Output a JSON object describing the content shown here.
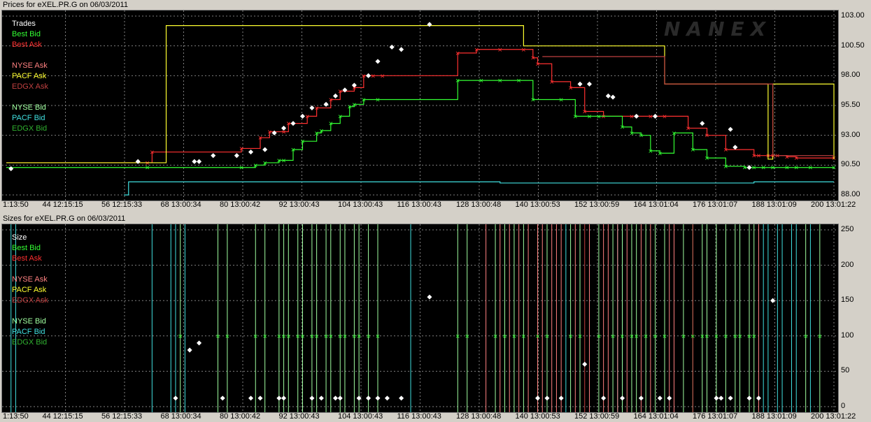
{
  "top_title": "Prices for  eXEL.PR.G  on  06/03/2011",
  "bottom_title": "Sizes for  eXEL.PR.G  on  06/03/2011",
  "logo_text": "NANEX",
  "colors": {
    "trades": "#ffffff",
    "best_bid": "#33ff33",
    "best_ask": "#ff3030",
    "nyse_ask": "#ff8080",
    "pacf_ask": "#ffff30",
    "edgx_ask": "#c04040",
    "nyse_bid": "#a0ffa0",
    "pacf_bid": "#40e0e0",
    "edgx_bid": "#30b030",
    "grid": "#808080"
  },
  "x_tick_labels": [
    "1:13:50",
    "44 12:15:15",
    "56 12:15:33",
    "68 13:00:34",
    "80 13:00:42",
    "92 13:00:43",
    "104 13:00:43",
    "116 13:00:43",
    "128 13:00:48",
    "140 13:00:53",
    "152 13:00:59",
    "164 13:01:04",
    "176 13:01:07",
    "188 13:01:09",
    "200 13:01:22"
  ],
  "chart_data": [
    {
      "type": "line",
      "panel": "prices",
      "title": "Prices for  eXEL.PR.G  on  06/03/2011",
      "ylim": [
        88.0,
        103.0
      ],
      "y_ticks": [
        "103.00",
        "100.50",
        "98.00",
        "95.50",
        "93.00",
        "90.50",
        "88.00"
      ],
      "x_index_range": [
        32,
        208
      ],
      "legend": [
        "Trades",
        "Best Bid",
        "Best Ask",
        "NYSE Ask",
        "PACF Ask",
        "EDGX Ask",
        "NYSE Bid",
        "PACF Bid",
        "EDGX Bid"
      ],
      "legend_position": "top-left",
      "grid": true,
      "series": [
        {
          "name": "Best Ask",
          "color_key": "best_ask",
          "x": [
            32,
            62,
            63,
            82,
            86,
            88,
            91,
            92,
            96,
            98,
            101,
            103,
            106,
            108,
            110,
            112,
            128,
            132,
            137,
            142,
            144,
            145,
            148,
            152,
            155,
            159,
            165,
            169,
            172,
            177,
            181,
            185,
            191,
            192,
            194,
            195,
            196,
            198,
            200,
            208
          ],
          "y": [
            90.7,
            90.7,
            91.6,
            91.9,
            92.8,
            93.3,
            93.3,
            94.0,
            94.6,
            95.3,
            96.0,
            96.7,
            97.0,
            98.0,
            98.0,
            98.0,
            99.9,
            100.2,
            100.2,
            100.2,
            99.5,
            99.0,
            97.5,
            97.0,
            95.0,
            94.6,
            94.6,
            94.6,
            94.6,
            93.6,
            93.0,
            91.8,
            91.3,
            91.3,
            91.3,
            91.3,
            91.3,
            91.2,
            91.1,
            91.1
          ]
        },
        {
          "name": "Best Bid",
          "color_key": "best_bid",
          "x": [
            32,
            62,
            82,
            85,
            87,
            90,
            91,
            93,
            95,
            98,
            99,
            101,
            103,
            105,
            106,
            108,
            111,
            128,
            133,
            137,
            141,
            144,
            150,
            153,
            156,
            158,
            163,
            165,
            167,
            169,
            171,
            174,
            178,
            181,
            185,
            189,
            191,
            193,
            195,
            198,
            200,
            203,
            208
          ],
          "y": [
            90.3,
            90.3,
            90.3,
            90.5,
            90.7,
            90.9,
            90.9,
            91.8,
            92.5,
            93.2,
            93.4,
            94.0,
            94.6,
            95.4,
            95.6,
            96.0,
            96.0,
            97.6,
            97.6,
            97.6,
            97.6,
            96.0,
            96.0,
            94.6,
            94.6,
            94.6,
            93.7,
            93.2,
            93.0,
            91.7,
            91.5,
            93.2,
            91.8,
            91.1,
            90.4,
            90.3,
            90.3,
            90.3,
            90.3,
            90.3,
            90.3,
            90.3,
            90.3
          ]
        },
        {
          "name": "PACF Ask",
          "color_key": "pacf_ask",
          "x": [
            32,
            62,
            65,
            66,
            140,
            142,
            171,
            172,
            193,
            194,
            195,
            208
          ],
          "y": [
            90.7,
            90.7,
            90.7,
            102.2,
            102.2,
            100.5,
            100.5,
            97.3,
            97.3,
            91.0,
            97.3,
            91.0
          ]
        },
        {
          "name": "EDGX Ask",
          "color_key": "edgx_ask",
          "x": [
            146,
            170,
            171,
            172,
            194,
            195,
            208
          ],
          "y": [
            99.6,
            99.6,
            99.6,
            97.3,
            97.3,
            91.3,
            91.3
          ]
        },
        {
          "name": "PACF Bid",
          "color_key": "pacf_bid",
          "x": [
            57,
            58,
            130,
            137,
            148,
            160,
            190,
            191,
            208
          ],
          "y": [
            88.0,
            89.1,
            89.1,
            89.0,
            89.0,
            89.0,
            89.0,
            89.1,
            89.1
          ]
        },
        {
          "name": "Trades",
          "type": "scatter",
          "color_key": "trades",
          "x": [
            33,
            60,
            72,
            73,
            76,
            81,
            84,
            87,
            89,
            91,
            93,
            95,
            97,
            100,
            102,
            104,
            106,
            109,
            111,
            114,
            116,
            122,
            154,
            156,
            160,
            161,
            166,
            170,
            180,
            186,
            187,
            190
          ],
          "y": [
            90.2,
            90.8,
            90.8,
            90.8,
            91.3,
            91.3,
            91.6,
            91.8,
            93.2,
            93.6,
            94.0,
            94.6,
            95.3,
            95.6,
            96.3,
            96.8,
            97.2,
            98.0,
            99.2,
            100.4,
            100.2,
            102.3,
            97.3,
            97.3,
            96.3,
            96.2,
            94.6,
            94.6,
            94.0,
            93.5,
            92.0,
            90.3
          ]
        }
      ]
    },
    {
      "type": "scatter",
      "panel": "sizes",
      "title": "Sizes for  eXEL.PR.G  on  06/03/2011",
      "ylim": [
        0,
        250
      ],
      "y_ticks": [
        "250",
        "200",
        "150",
        "100",
        "50",
        "0"
      ],
      "x_index_range": [
        32,
        208
      ],
      "legend": [
        "Size",
        "Best Bid",
        "Best Ask",
        "NYSE Ask",
        "PACF Ask",
        "EDGX Ask",
        "NYSE Bid",
        "PACF Bid",
        "EDGX Bid"
      ],
      "legend_position": "top-left",
      "grid": true,
      "series": [
        {
          "name": "Size",
          "color_key": "trades",
          "x": [
            68,
            71,
            73,
            78,
            84,
            86,
            90,
            91,
            97,
            99,
            102,
            103,
            107,
            109,
            111,
            113,
            116,
            122,
            145,
            147,
            150,
            155,
            159,
            163,
            167,
            171,
            173,
            183,
            184,
            186,
            190,
            192,
            195
          ],
          "y": [
            12,
            80,
            90,
            12,
            12,
            12,
            12,
            12,
            12,
            12,
            12,
            12,
            12,
            12,
            12,
            12,
            12,
            155,
            12,
            12,
            12,
            60,
            12,
            12,
            12,
            12,
            12,
            12,
            12,
            12,
            12,
            12,
            150
          ]
        }
      ],
      "vertical_lines": [
        {
          "color_key": "pacf_bid",
          "x": [
            33,
            34,
            63,
            67,
            68,
            70,
            118,
            151,
            162,
            163,
            193,
            194,
            196,
            197,
            199,
            200,
            203
          ]
        },
        {
          "color_key": "nyse_bid",
          "x": [
            69,
            77,
            79,
            85,
            87,
            90,
            91,
            92,
            94,
            95,
            97,
            98,
            100,
            101,
            103,
            104,
            106,
            107,
            109,
            111,
            128,
            130,
            136,
            138,
            140,
            142,
            145,
            147,
            152,
            154,
            158,
            161,
            163,
            165,
            166,
            168,
            170,
            172,
            176,
            178,
            180,
            181,
            183,
            185,
            187,
            188,
            190,
            191,
            202,
            205
          ]
        },
        {
          "color_key": "nyse_ask",
          "x": [
            134,
            137,
            139,
            141,
            143,
            145,
            146,
            148,
            149,
            150,
            153,
            156,
            159,
            160,
            162,
            164,
            167,
            169,
            173,
            174,
            192
          ]
        },
        {
          "color_key": "edgx_ask",
          "x": [
            155,
            178
          ]
        }
      ]
    }
  ]
}
